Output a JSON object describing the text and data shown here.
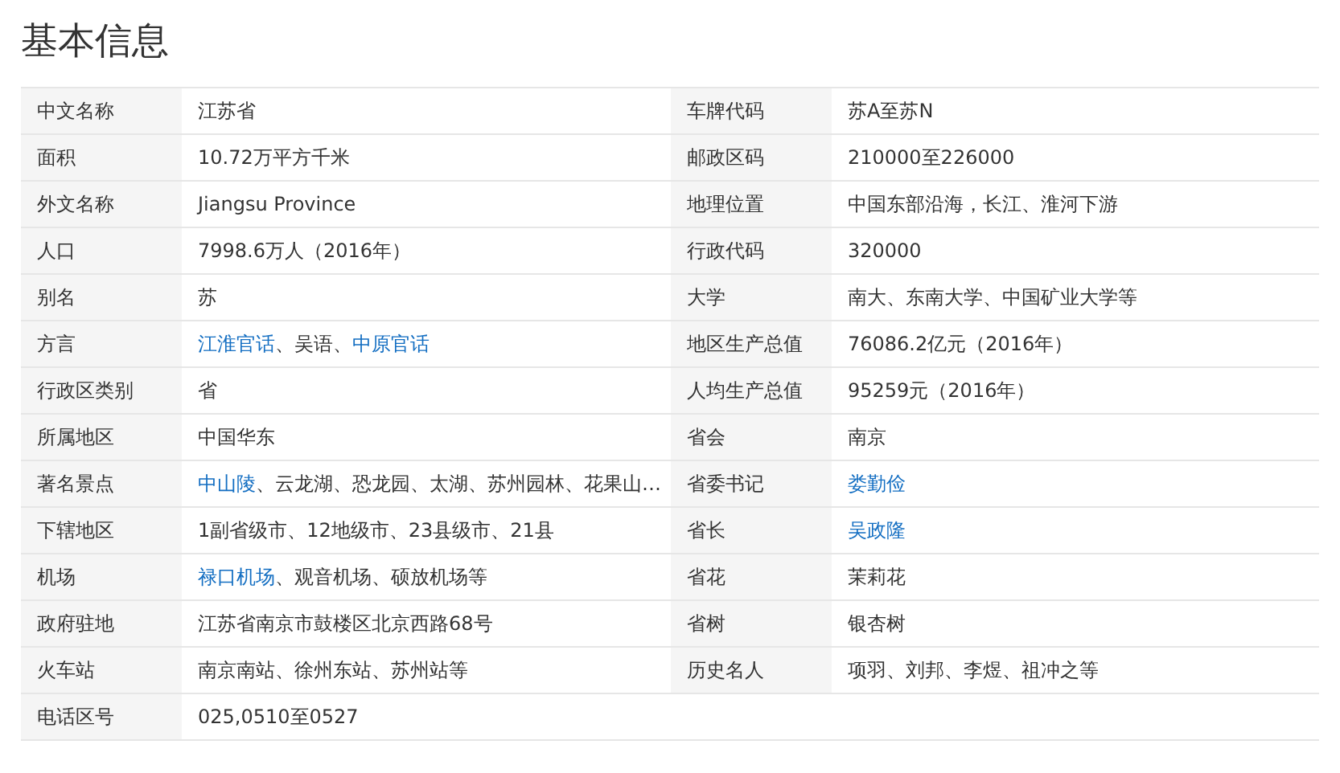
{
  "title": "基本信息",
  "rows": [
    {
      "left": {
        "label": "中文名称",
        "value": [
          {
            "text": "江苏省",
            "link": false
          }
        ]
      },
      "right": {
        "label": "车牌代码",
        "value": [
          {
            "text": "苏A至苏N",
            "link": false
          }
        ]
      }
    },
    {
      "left": {
        "label": "面积",
        "value": [
          {
            "text": "10.72万平方千米",
            "link": false
          }
        ]
      },
      "right": {
        "label": "邮政区码",
        "value": [
          {
            "text": "210000至226000",
            "link": false
          }
        ]
      }
    },
    {
      "left": {
        "label": "外文名称",
        "value": [
          {
            "text": "Jiangsu Province",
            "link": false
          }
        ]
      },
      "right": {
        "label": "地理位置",
        "value": [
          {
            "text": "中国东部沿海，长江、淮河下游",
            "link": false
          }
        ]
      }
    },
    {
      "left": {
        "label": "人口",
        "value": [
          {
            "text": "7998.6万人（2016年）",
            "link": false
          }
        ]
      },
      "right": {
        "label": "行政代码",
        "value": [
          {
            "text": "320000",
            "link": false
          }
        ]
      }
    },
    {
      "left": {
        "label": "别名",
        "value": [
          {
            "text": "苏",
            "link": false
          }
        ]
      },
      "right": {
        "label": "大学",
        "value": [
          {
            "text": "南大、东南大学、中国矿业大学等",
            "link": false
          }
        ]
      }
    },
    {
      "left": {
        "label": "方言",
        "value": [
          {
            "text": "江淮官话",
            "link": true
          },
          {
            "text": "、吴语、",
            "link": false
          },
          {
            "text": "中原官话",
            "link": true
          }
        ]
      },
      "right": {
        "label": "地区生产总值",
        "value": [
          {
            "text": "76086.2亿元（2016年）",
            "link": false
          }
        ]
      }
    },
    {
      "left": {
        "label": "行政区类别",
        "value": [
          {
            "text": "省",
            "link": false
          }
        ]
      },
      "right": {
        "label": "人均生产总值",
        "value": [
          {
            "text": "95259元（2016年）",
            "link": false
          }
        ]
      }
    },
    {
      "left": {
        "label": "所属地区",
        "value": [
          {
            "text": "中国华东",
            "link": false
          }
        ]
      },
      "right": {
        "label": "省会",
        "value": [
          {
            "text": "南京",
            "link": false
          }
        ]
      }
    },
    {
      "left": {
        "label": "著名景点",
        "value": [
          {
            "text": "中山陵",
            "link": true
          },
          {
            "text": "、云龙湖、恐龙园、太湖、苏州园林、花果山…",
            "link": false
          }
        ]
      },
      "right": {
        "label": "省委书记",
        "value": [
          {
            "text": "娄勤俭",
            "link": true
          }
        ]
      }
    },
    {
      "left": {
        "label": "下辖地区",
        "value": [
          {
            "text": "1副省级市、12地级市、23县级市、21县",
            "link": false
          }
        ]
      },
      "right": {
        "label": "省长",
        "value": [
          {
            "text": "吴政隆",
            "link": true
          }
        ]
      }
    },
    {
      "left": {
        "label": "机场",
        "value": [
          {
            "text": "禄口机场",
            "link": true
          },
          {
            "text": "、观音机场、硕放机场等",
            "link": false
          }
        ]
      },
      "right": {
        "label": "省花",
        "value": [
          {
            "text": "茉莉花",
            "link": false
          }
        ]
      }
    },
    {
      "left": {
        "label": "政府驻地",
        "value": [
          {
            "text": "江苏省南京市鼓楼区北京西路68号",
            "link": false
          }
        ]
      },
      "right": {
        "label": "省树",
        "value": [
          {
            "text": "银杏树",
            "link": false
          }
        ]
      }
    },
    {
      "left": {
        "label": "火车站",
        "value": [
          {
            "text": "南京南站、徐州东站、苏州站等",
            "link": false
          }
        ]
      },
      "right": {
        "label": "历史名人",
        "value": [
          {
            "text": "项羽、刘邦、李煜、祖冲之等",
            "link": false
          }
        ]
      }
    },
    {
      "left": {
        "label": "电话区号",
        "value": [
          {
            "text": "025,0510至0527",
            "link": false
          }
        ]
      }
    }
  ]
}
